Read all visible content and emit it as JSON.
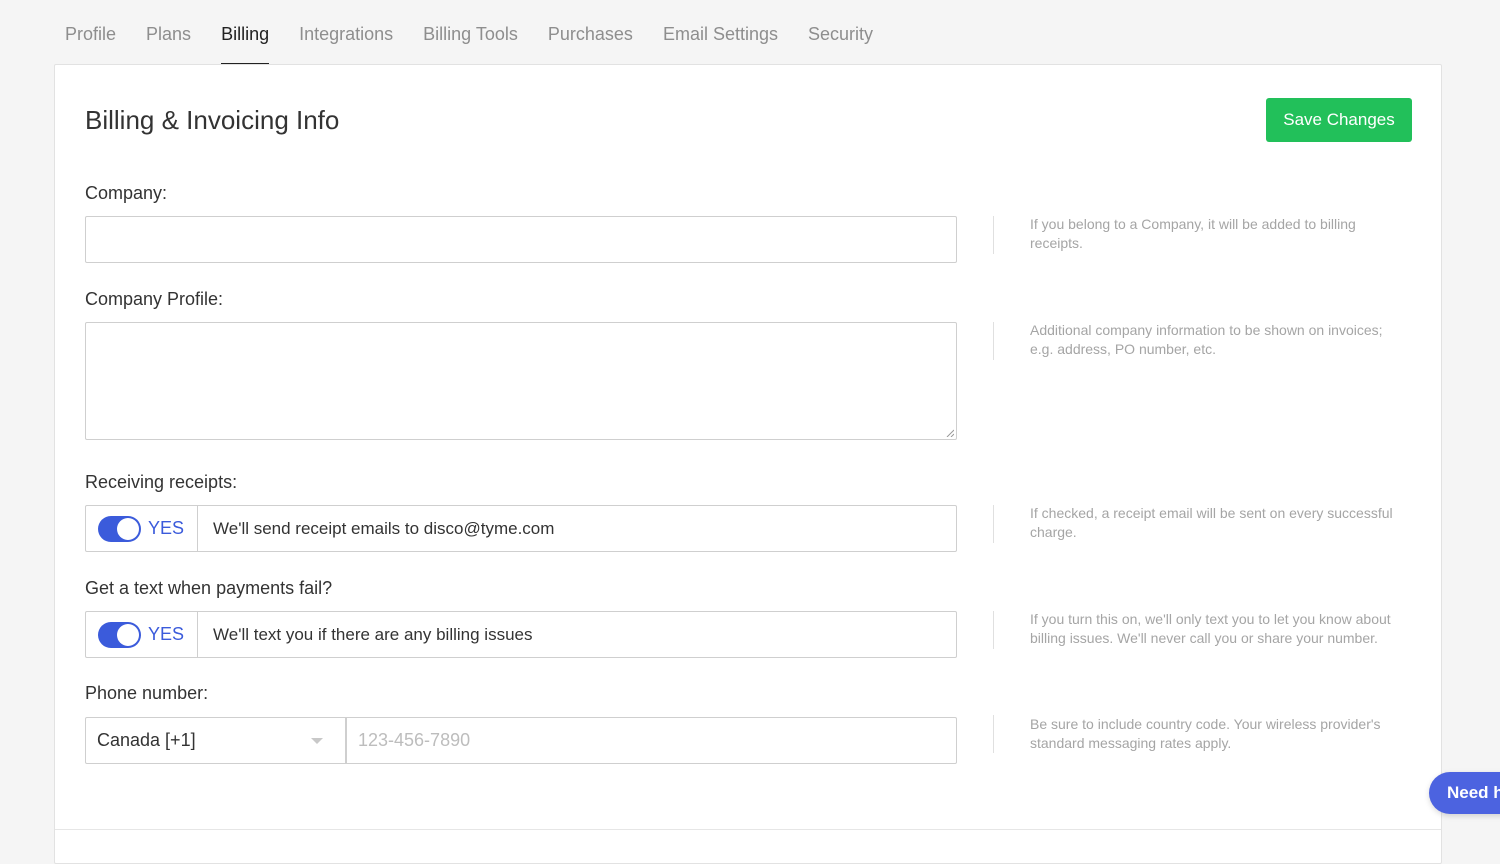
{
  "tabs": [
    "Profile",
    "Plans",
    "Billing",
    "Integrations",
    "Billing Tools",
    "Purchases",
    "Email Settings",
    "Security"
  ],
  "active_tab": "Billing",
  "title": "Billing & Invoicing Info",
  "save_label": "Save Changes",
  "company": {
    "label": "Company:",
    "value": "",
    "help": "If you belong to a Company, it will be added to billing receipts."
  },
  "company_profile": {
    "label": "Company Profile:",
    "value": "",
    "help": "Additional company information to be shown on invoices; e.g. address, PO number, etc."
  },
  "receipts": {
    "label": "Receiving receipts:",
    "toggle": "YES",
    "text": "We'll send receipt emails to disco@tyme.com",
    "help": "If checked, a receipt email will be sent on every successful charge."
  },
  "sms": {
    "label": "Get a text when payments fail?",
    "toggle": "YES",
    "text": "We'll text you if there are any billing issues",
    "help": "If you turn this on, we'll only text you to let you know about billing issues. We'll never call you or share your number."
  },
  "phone": {
    "label": "Phone number:",
    "country": "Canada [+1]",
    "placeholder": "123-456-7890",
    "value": "",
    "help": "Be sure to include country code. Your wireless provider's standard messaging rates apply."
  },
  "help_button": "Need h",
  "colors": {
    "accent": "#3b5bdb",
    "save": "#22c05a",
    "help_button": "#4c63e0"
  }
}
